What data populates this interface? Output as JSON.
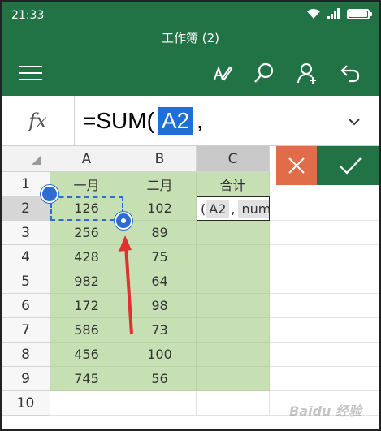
{
  "status": {
    "time": "21:33"
  },
  "title": "工作簿 (2)",
  "toolbar": {
    "menu_icon": "hamburger-menu-icon",
    "pen_icon": "pen-draw-icon",
    "search_icon": "search-icon",
    "share_icon": "add-person-icon",
    "undo_icon": "undo-icon"
  },
  "formula_bar": {
    "fx": "fx",
    "before": "=SUM(",
    "ref": "A2",
    "after": ","
  },
  "columns": [
    "A",
    "B",
    "C"
  ],
  "rows": [
    "1",
    "2",
    "3",
    "4",
    "5",
    "6",
    "7",
    "8",
    "9",
    "10"
  ],
  "header_row": {
    "a": "一月",
    "b": "二月",
    "c": "合计"
  },
  "data_rows": [
    {
      "a": "126",
      "b": "102"
    },
    {
      "a": "256",
      "b": "89"
    },
    {
      "a": "428",
      "b": "75"
    },
    {
      "a": "982",
      "b": "64"
    },
    {
      "a": "172",
      "b": "98"
    },
    {
      "a": "586",
      "b": "73"
    },
    {
      "a": "456",
      "b": "100"
    },
    {
      "a": "745",
      "b": "56"
    }
  ],
  "edit_cell": {
    "prefix": "(",
    "ref": "A2",
    "sep": ",",
    "hint": "num"
  },
  "colors": {
    "ribbon": "#217346",
    "cancel": "#e06c4a",
    "selection": "#2f6cd1",
    "range_fill": "#c6e0b4",
    "annotation_arrow": "#e03030"
  },
  "watermark": "Baidu 经验"
}
